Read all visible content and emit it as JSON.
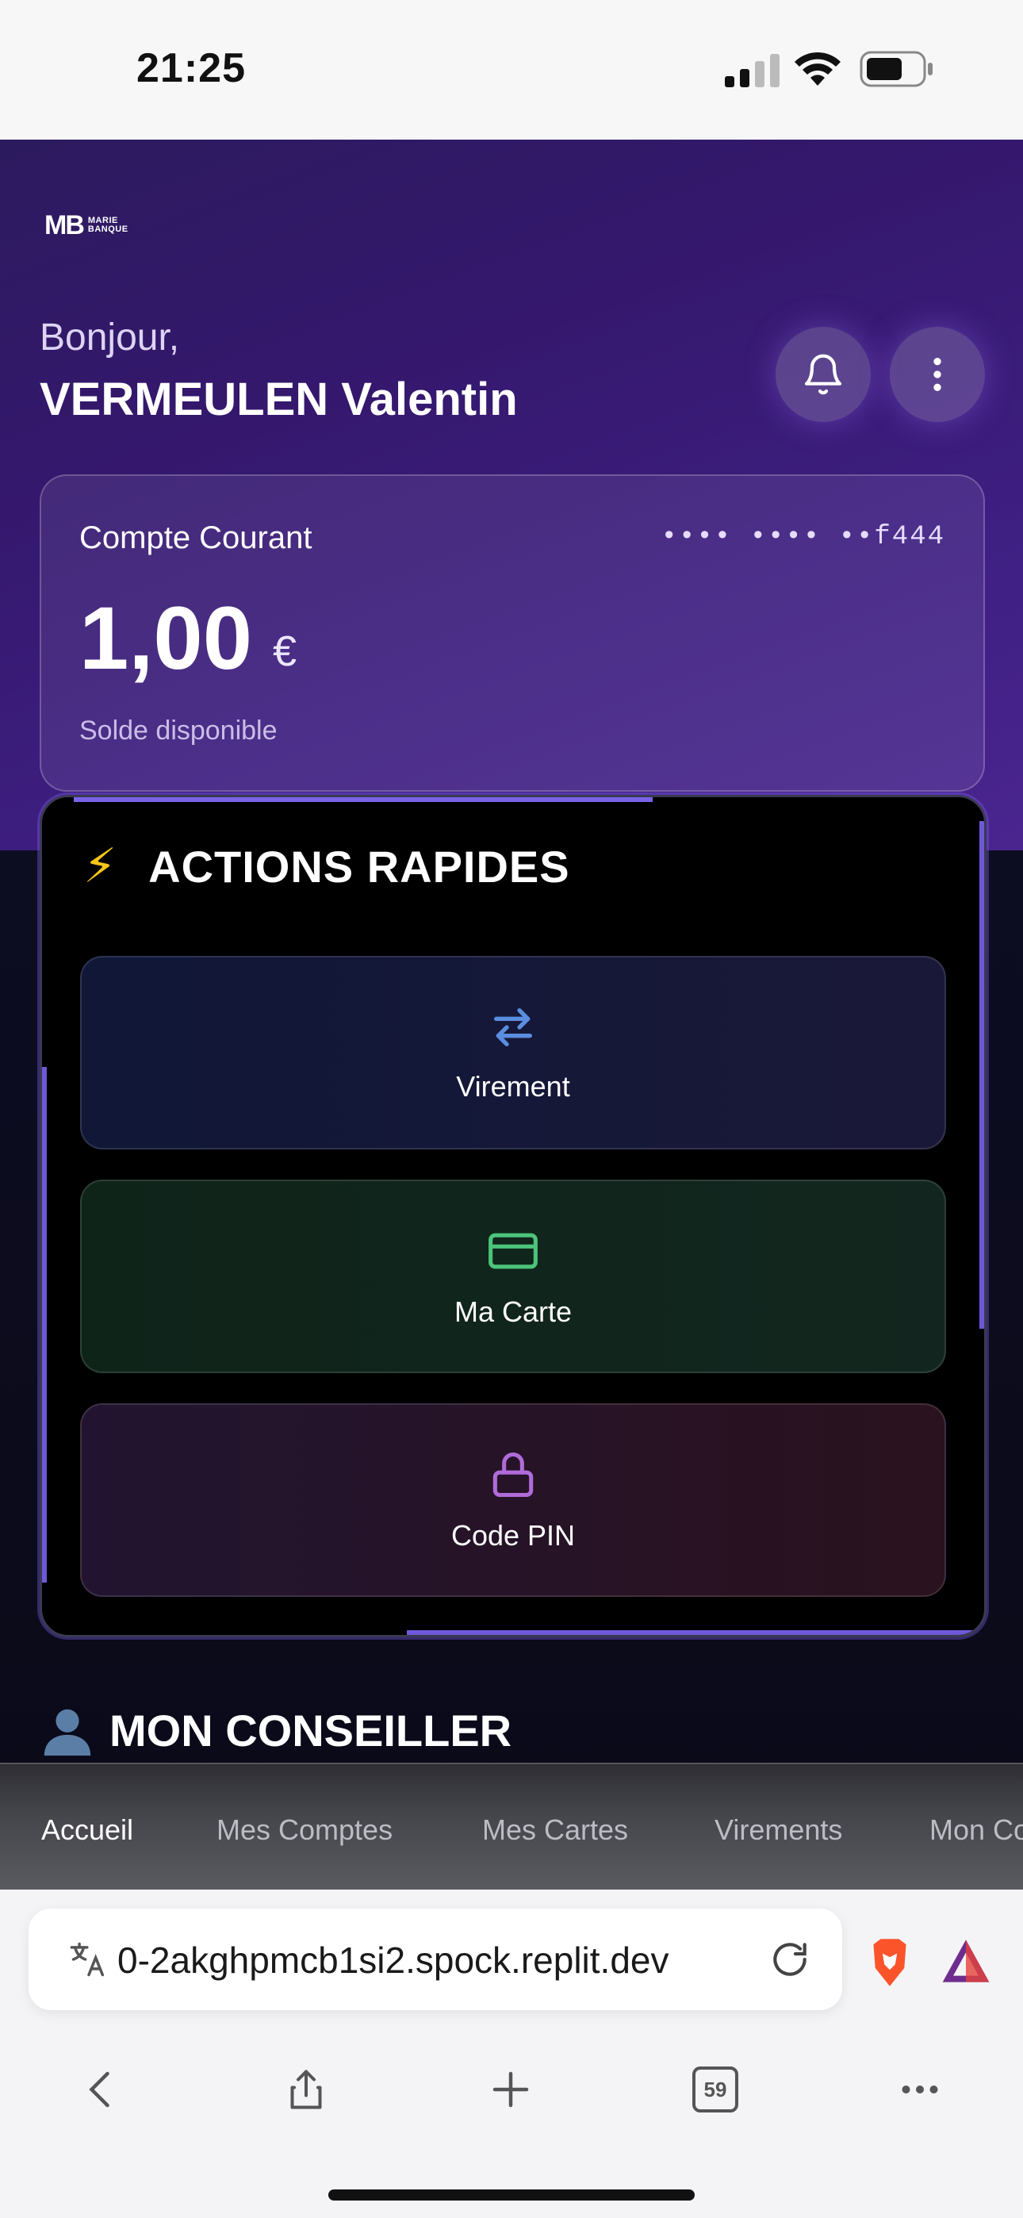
{
  "status_bar": {
    "time": "21:25"
  },
  "app": {
    "logo": {
      "mark": "MB",
      "line1": "MARIE",
      "line2": "BANQUE"
    },
    "greeting": "Bonjour,",
    "user_name": "VERMEULEN Valentin",
    "account": {
      "title": "Compte Courant",
      "number_masked": "•••• •••• ••f444",
      "balance": "1,00",
      "currency": "€",
      "balance_label": "Solde disponible"
    },
    "quick_actions": {
      "icon": "⚡",
      "title": "ACTIONS RAPIDES",
      "items": [
        {
          "label": "Virement",
          "icon": "transfer-arrows-icon",
          "color": "#5b8de0"
        },
        {
          "label": "Ma Carte",
          "icon": "credit-card-icon",
          "color": "#4cc47a"
        },
        {
          "label": "Code PIN",
          "icon": "lock-icon",
          "color": "#b06bd9"
        }
      ]
    },
    "advisor": {
      "title": "MON CONSEILLER"
    },
    "tabs": [
      "Accueil",
      "Mes Comptes",
      "Mes Cartes",
      "Virements",
      "Mon Co"
    ]
  },
  "browser": {
    "url": "0-2akghpmcb1si2.spock.replit.dev",
    "tab_count": "59"
  }
}
